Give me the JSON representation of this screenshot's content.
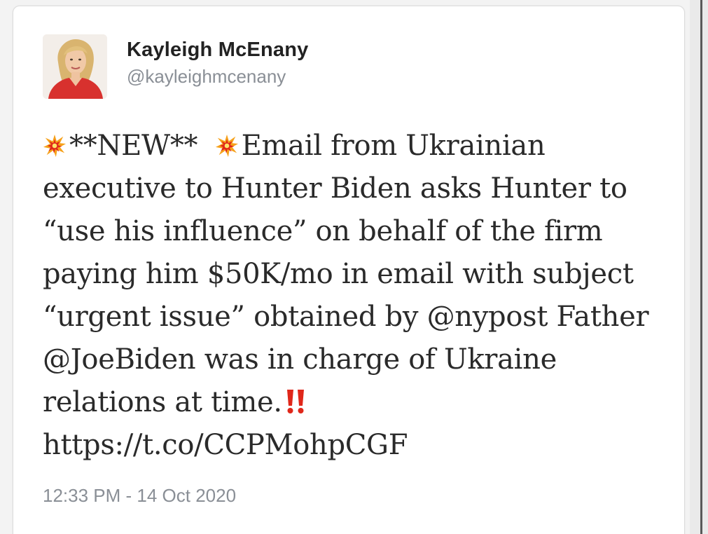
{
  "tweet": {
    "author": {
      "display_name": "Kayleigh McEnany",
      "handle": "@kayleighmcenany",
      "avatar_icon": "profile-photo"
    },
    "body": {
      "line1_pre": "**NEW**",
      "line1_post": "Email from Ukrainian",
      "line2": "executive to Hunter Biden asks Hunter to",
      "line3": "“use his influence” on behalf of the firm",
      "line4": "paying him $50K/mo in email with subject",
      "line5": "“urgent issue” obtained by @nypost Father",
      "line6": "@JoeBiden was in charge of Ukraine",
      "line7": "relations at time.",
      "line8": "https://t.co/CCPMohpCGF"
    },
    "emoji": {
      "collision_icon": "collision-emoji",
      "double_exclamation_icon": "double-exclamation-emoji",
      "accent_red": "#e0271a",
      "accent_orange": "#f6a11a"
    },
    "timestamp": "12:33 PM - 14 Oct 2020"
  }
}
